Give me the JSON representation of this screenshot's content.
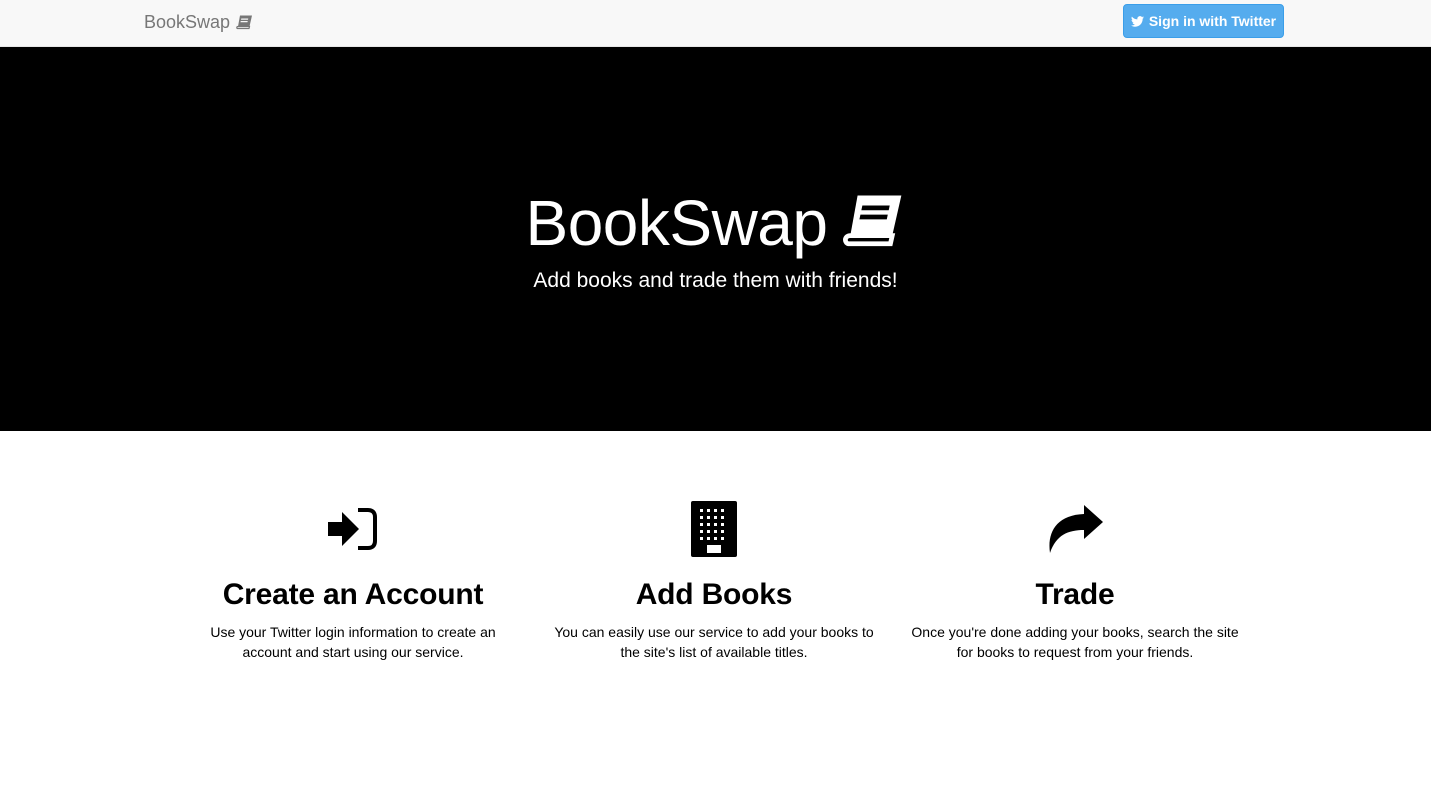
{
  "navbar": {
    "brand": "BookSwap",
    "brand_icon": "book-icon",
    "signin_label": "Sign in with Twitter",
    "signin_icon": "twitter-icon",
    "signin_color": "#55acee"
  },
  "hero": {
    "title": "BookSwap",
    "title_icon": "book-icon",
    "subtitle": "Add books and trade them with friends!"
  },
  "features": [
    {
      "icon": "sign-in-icon",
      "title": "Create an Account",
      "text": "Use your Twitter login information to create an account and start using our service."
    },
    {
      "icon": "building-icon",
      "title": "Add Books",
      "text": "You can easily use our service to add your books to the site's list of available titles."
    },
    {
      "icon": "share-arrow-icon",
      "title": "Trade",
      "text": "Once you're done adding your books, search the site for books to request from your friends."
    }
  ]
}
